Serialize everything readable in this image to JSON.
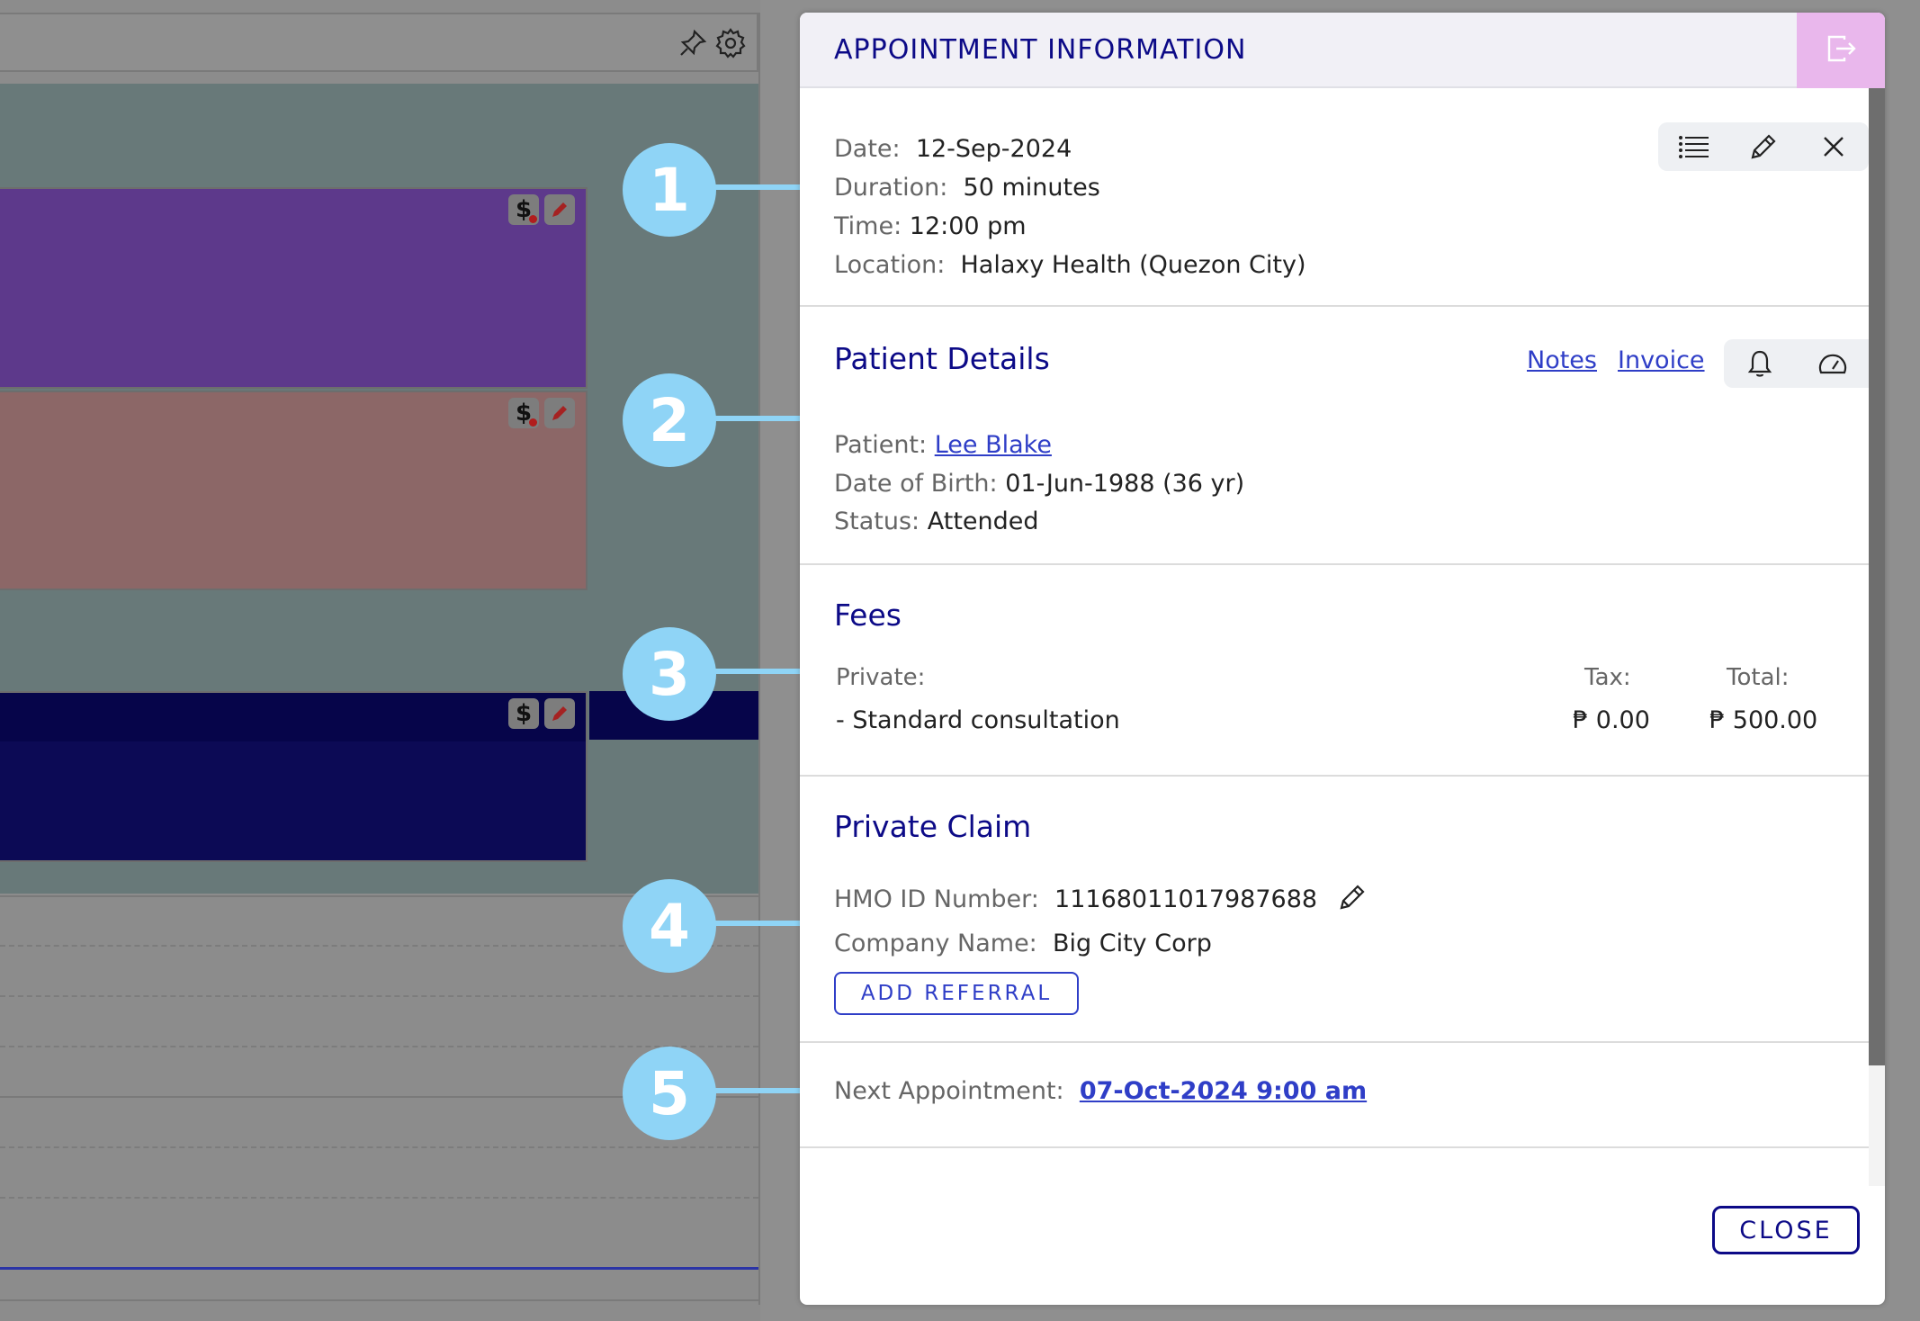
{
  "panel": {
    "title": "APPOINTMENT INFORMATION",
    "header_accent": "#e9b7ec",
    "title_color": "#0c0a87"
  },
  "appointment": {
    "date_label": "Date:",
    "date": "12-Sep-2024",
    "duration_label": "Duration:",
    "duration": "50 minutes",
    "time_label": "Time:",
    "time": "12:00 pm",
    "location_label": "Location:",
    "location": "Halaxy Health (Quezon City)"
  },
  "patient": {
    "heading": "Patient Details",
    "notes_link": "Notes",
    "invoice_link": "Invoice",
    "patient_label": "Patient:",
    "patient_name": "Lee Blake",
    "dob_label": "Date of Birth:",
    "dob": "01-Jun-1988 (36 yr)",
    "status_label": "Status:",
    "status": "Attended"
  },
  "fees": {
    "heading": "Fees",
    "private_label": "Private:",
    "tax_label": "Tax:",
    "total_label": "Total:",
    "item": "- Standard consultation",
    "tax": "₱ 0.00",
    "total": "₱ 500.00"
  },
  "claim": {
    "heading": "Private Claim",
    "hmo_label": "HMO ID Number:",
    "hmo_id": "11168011017987688",
    "company_label": "Company Name:",
    "company": "Big City Corp",
    "add_referral": "ADD REFERRAL"
  },
  "next": {
    "label": "Next Appointment:",
    "value": "07-Oct-2024 9:00 am"
  },
  "footer": {
    "close": "CLOSE"
  },
  "callouts": [
    "1",
    "2",
    "3",
    "4",
    "5"
  ],
  "icons": {
    "toolbar_top": [
      "pin-icon",
      "gear-icon"
    ],
    "appointment_tools": [
      "list-icon",
      "pencil-icon",
      "close-icon"
    ],
    "patient_tools": [
      "bell-icon",
      "gauge-icon"
    ],
    "header": "exit-icon",
    "block_icons": [
      "dollar-icon",
      "edit-icon"
    ]
  },
  "colors": {
    "callout": "#8fd4f6",
    "link": "#2f3ec7",
    "appt_purple": "#5d398b",
    "appt_salmon": "#8c6767",
    "appt_navy": "#0c0a55"
  }
}
